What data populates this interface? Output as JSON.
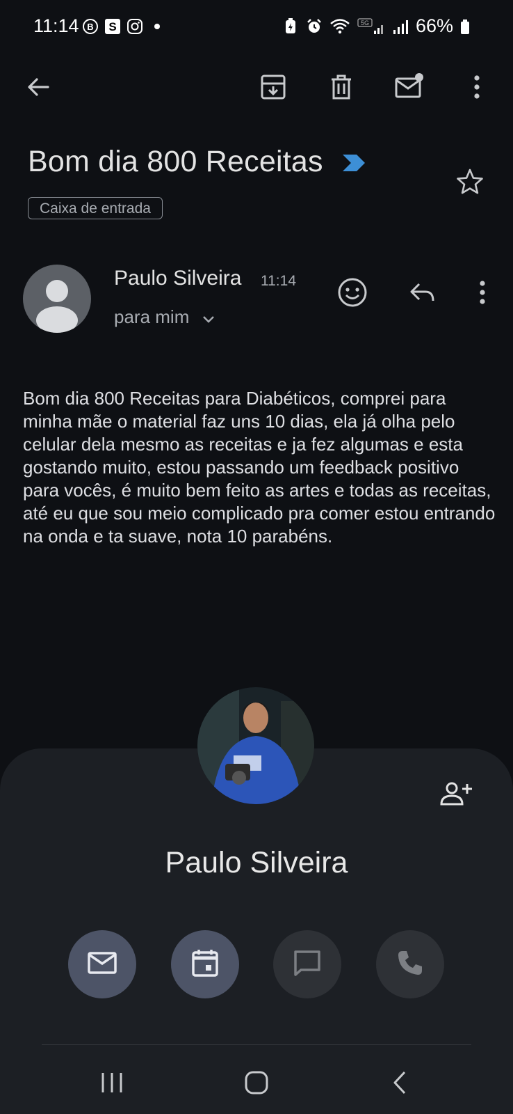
{
  "status_bar": {
    "time": "11:14",
    "battery": "66%",
    "left_icons": [
      "b-circle-icon",
      "s-app-icon",
      "instagram-icon",
      "dot-icon"
    ],
    "right_icons": [
      "battery-saver-icon",
      "alarm-icon",
      "wifi-icon",
      "signal-5g-icon",
      "signal-icon"
    ]
  },
  "toolbar": {
    "icons": [
      "back-arrow-icon",
      "archive-icon",
      "delete-icon",
      "mark-unread-icon",
      "more-vert-icon"
    ]
  },
  "email": {
    "subject": "Bom dia 800 Receitas",
    "label": "Caixa de entrada",
    "sender": "Paulo Silveira",
    "time": "11:14",
    "recipient": "para mim",
    "body": "Bom dia 800 Receitas para Diabéticos, comprei para minha mãe o material faz uns 10 dias, ela já olha pelo celular dela mesmo as receitas e ja fez algumas e esta gostando muito, estou passando um feedback positivo para vocês, é muito bem feito as artes e todas as receitas, até eu que sou meio complicado pra comer estou entrando na onda e ta suave, nota 10 parabéns."
  },
  "contact_card": {
    "name": "Paulo Silveira",
    "actions": [
      "email-icon",
      "calendar-icon",
      "chat-icon",
      "phone-icon"
    ]
  },
  "colors": {
    "background": "#0e1014",
    "sheet": "#1c1f24",
    "importance_marker": "#3d8fd6",
    "action_active": "#4d5467",
    "action_inactive": "#2e3136"
  }
}
